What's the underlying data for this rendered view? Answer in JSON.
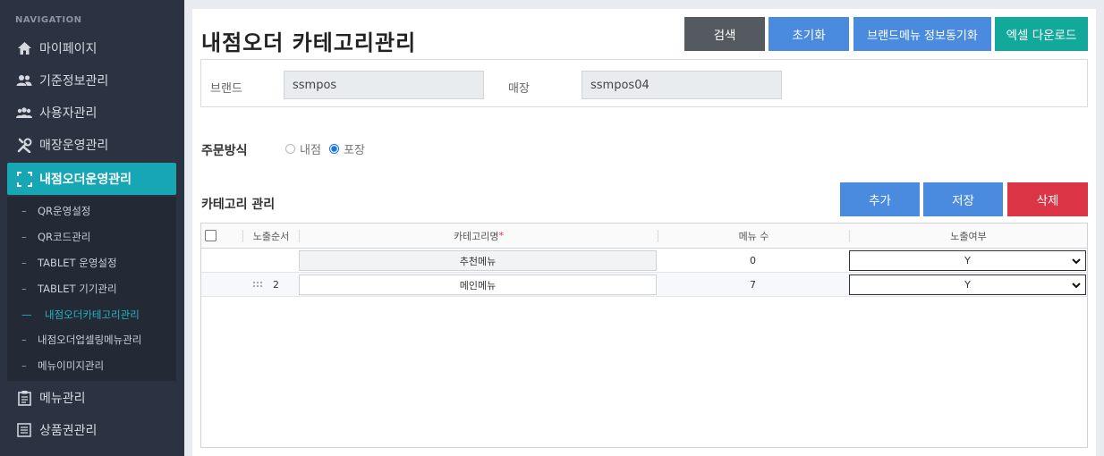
{
  "sidebar": {
    "heading": "NAVIGATION",
    "items": [
      {
        "label": "마이페이지",
        "icon": "home-icon"
      },
      {
        "label": "기준정보관리",
        "icon": "users-icon"
      },
      {
        "label": "사용자관리",
        "icon": "user-group-icon"
      },
      {
        "label": "매장운영관리",
        "icon": "tools-icon"
      },
      {
        "label": "내점오더운영관리",
        "icon": "scan-icon",
        "active": true
      },
      {
        "label": "메뉴관리",
        "icon": "clipboard-icon"
      },
      {
        "label": "상품권관리",
        "icon": "list-icon"
      }
    ],
    "subitems": [
      {
        "label": "QR운영설정"
      },
      {
        "label": "QR코드관리"
      },
      {
        "label": "TABLET 운영설정"
      },
      {
        "label": "TABLET 기기관리"
      },
      {
        "label": "내점오더카테고리관리",
        "active": true
      },
      {
        "label": "내점오더업셀링메뉴관리"
      },
      {
        "label": "메뉴이미지관리"
      }
    ]
  },
  "header": {
    "title": "내점오더 카테고리관리",
    "buttons": {
      "search": "검색",
      "reset": "초기화",
      "sync": "브랜드메뉴 정보동기화",
      "excel": "엑셀 다운로드"
    }
  },
  "filters": {
    "brand_label": "브랜드",
    "brand_value": "ssmpos",
    "store_label": "매장",
    "store_value": "ssmpos04"
  },
  "order_type": {
    "label": "주문방식",
    "options": [
      "내점",
      "포장"
    ],
    "selected": "포장"
  },
  "category": {
    "title": "카테고리 관리",
    "buttons": {
      "add": "추가",
      "save": "저장",
      "delete": "삭제"
    },
    "columns": {
      "order": "노출순서",
      "name": "카테고리명",
      "required_mark": "*",
      "count": "메뉴 수",
      "visible": "노출여부"
    },
    "rows": [
      {
        "order": "",
        "name": "추천메뉴",
        "count": "0",
        "visible": "Y"
      },
      {
        "order": "2",
        "name": "메인메뉴",
        "count": "7",
        "visible": "Y"
      }
    ]
  }
}
